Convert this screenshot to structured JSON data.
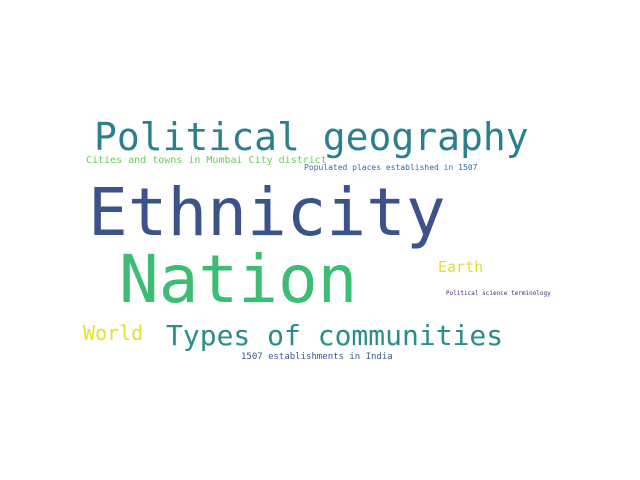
{
  "words": [
    {
      "text": "Ethnicity",
      "color": "#3b528b"
    },
    {
      "text": "Nation",
      "color": "#3dbc74"
    },
    {
      "text": "Political geography",
      "color": "#2c7f8e"
    },
    {
      "text": "Types of communities",
      "color": "#2a8d8a"
    },
    {
      "text": "World",
      "color": "#e6df2c"
    },
    {
      "text": "Earth",
      "color": "#e2dd32"
    },
    {
      "text": "Cities and towns in Mumbai City district",
      "color": "#6cce59"
    },
    {
      "text": "Populated places established in 1507",
      "color": "#3d6a96"
    },
    {
      "text": "1507 establishments in India",
      "color": "#3a578c"
    },
    {
      "text": "Political science terminology",
      "color": "#482677"
    }
  ]
}
